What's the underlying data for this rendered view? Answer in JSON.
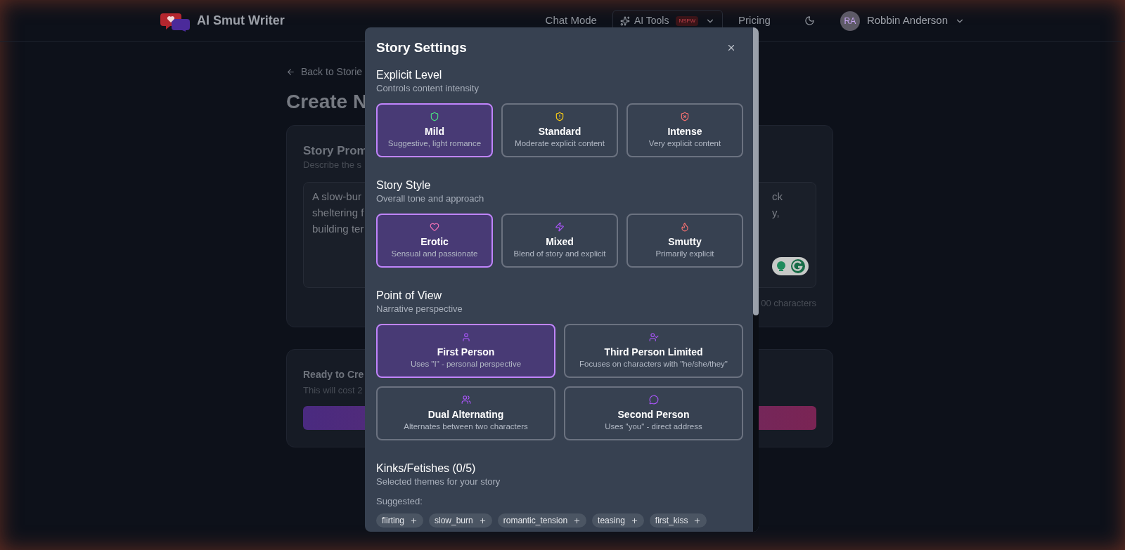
{
  "header": {
    "app_name": "AI Smut Writer",
    "nav": [
      {
        "kind": "link",
        "label": "Chat Mode"
      },
      {
        "kind": "menu",
        "label": "AI Tools",
        "badge": "NSFW"
      },
      {
        "kind": "link",
        "label": "Pricing"
      }
    ],
    "user": {
      "initials": "RA",
      "name": "Robbin Anderson"
    }
  },
  "page": {
    "back_link": "Back to Storie",
    "title": "Create N",
    "prompt_card": {
      "title": "Story Prom",
      "subtitle": "Describe the s",
      "text_left": [
        "A slow-bur",
        "sheltering f",
        "building ter"
      ],
      "text_right": [
        "ck",
        "y,"
      ],
      "counter": "00 characters"
    },
    "ready_card": {
      "title": "Ready to Cre",
      "subtitle": "This will cost 2"
    }
  },
  "modal": {
    "title": "Story Settings",
    "sections": [
      {
        "title": "Explicit Level",
        "subtitle": "Controls content intensity",
        "options": [
          {
            "label": "Mild",
            "description": "Suggestive, light romance",
            "selected": true
          },
          {
            "label": "Standard",
            "description": "Moderate explicit content",
            "selected": false
          },
          {
            "label": "Intense",
            "description": "Very explicit content",
            "selected": false
          }
        ]
      },
      {
        "title": "Story Style",
        "subtitle": "Overall tone and approach",
        "options": [
          {
            "label": "Erotic",
            "description": "Sensual and passionate",
            "selected": true
          },
          {
            "label": "Mixed",
            "description": "Blend of story and explicit",
            "selected": false
          },
          {
            "label": "Smutty",
            "description": "Primarily explicit",
            "selected": false
          }
        ]
      },
      {
        "title": "Point of View",
        "subtitle": "Narrative perspective",
        "options": [
          {
            "label": "First Person",
            "description": "Uses \"I\" - personal perspective",
            "selected": true
          },
          {
            "label": "Third Person Limited",
            "description": "Focuses on characters with \"he/she/they\"",
            "selected": false
          },
          {
            "label": "Dual Alternating",
            "description": "Alternates between two characters",
            "selected": false
          },
          {
            "label": "Second Person",
            "description": "Uses \"you\" - direct address",
            "selected": false
          }
        ]
      }
    ],
    "kinks": {
      "title": "Kinks/Fetishes (0/5)",
      "subtitle": "Selected themes for your story",
      "suggested_label": "Suggested:",
      "tags": [
        "flirting",
        "slow_burn",
        "romantic_tension",
        "teasing",
        "first_kiss"
      ]
    }
  }
}
